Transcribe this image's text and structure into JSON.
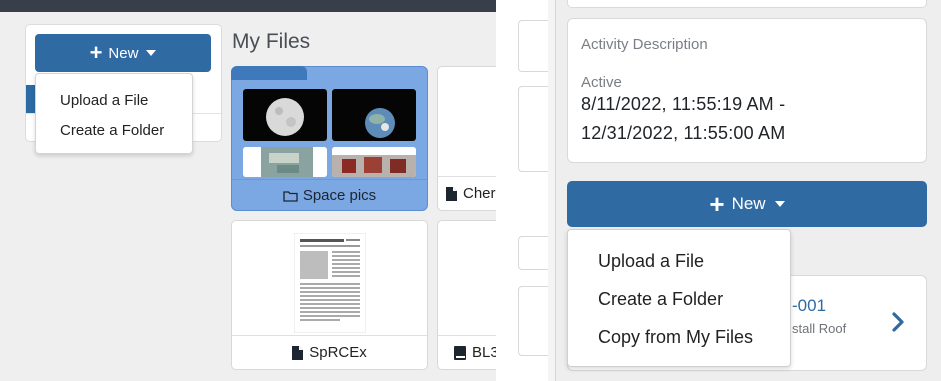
{
  "left_panel": {
    "new_button": {
      "label": "New"
    },
    "new_menu": {
      "items": [
        "Upload a File",
        "Create a Folder"
      ]
    },
    "section_title": "My Files",
    "folder": {
      "name": "Space pics"
    },
    "files": [
      {
        "name": "Cher"
      },
      {
        "name": "SpRCEx"
      },
      {
        "name": "BL3"
      }
    ]
  },
  "right_panel": {
    "activity": {
      "heading": "Activity Description",
      "status_label": "Active",
      "date_start": "8/11/2022, 11:55:19 AM -",
      "date_end": "12/31/2022, 11:55:00 AM"
    },
    "new_button": {
      "label": "New"
    },
    "new_menu": {
      "items": [
        "Upload a File",
        "Create a Folder",
        "Copy from My Files"
      ]
    },
    "task": {
      "code_partial": "-001",
      "subtitle_partial": "stall Roof"
    }
  },
  "colors": {
    "primary_button": "#2f6aa3",
    "folder_fill": "#7ba7e3",
    "topbar": "#383f4a",
    "link": "#2f6aa3"
  },
  "icons": {
    "plus": "plus-icon",
    "caret": "caret-down-icon",
    "folder": "folder-outline-icon",
    "file": "file-icon",
    "book": "book-icon",
    "chevron": "chevron-right-icon"
  }
}
